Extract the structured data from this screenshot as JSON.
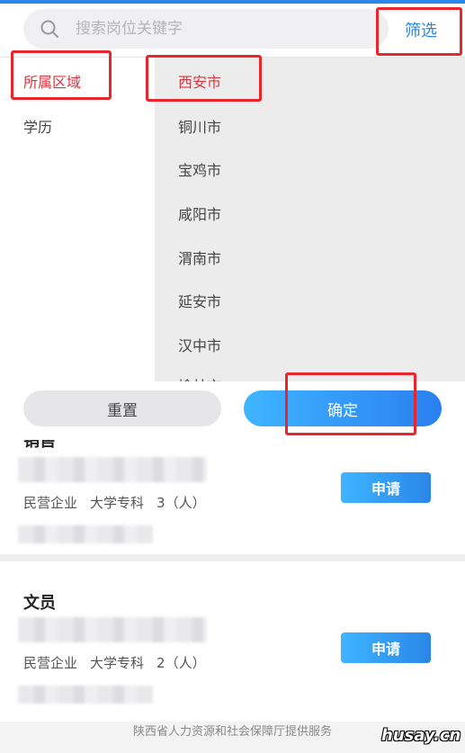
{
  "search": {
    "placeholder": "搜索岗位关键字"
  },
  "header": {
    "filter_label": "筛选"
  },
  "filter": {
    "categories": [
      {
        "label": "所属区域",
        "active": true
      },
      {
        "label": "学历",
        "active": false
      }
    ],
    "cities": [
      {
        "label": "西安市",
        "active": true
      },
      {
        "label": "铜川市"
      },
      {
        "label": "宝鸡市"
      },
      {
        "label": "咸阳市"
      },
      {
        "label": "渭南市"
      },
      {
        "label": "延安市"
      },
      {
        "label": "汉中市"
      },
      {
        "label": "榆林市"
      }
    ],
    "reset_label": "重置",
    "confirm_label": "确定"
  },
  "jobs": [
    {
      "title": "销售",
      "company_type": "民营企业",
      "education": "大学专科",
      "count": "3（人）",
      "apply_label": "申请"
    },
    {
      "title": "文员",
      "company_type": "民营企业",
      "education": "大学专科",
      "count": "2（人）",
      "apply_label": "申请"
    }
  ],
  "footer": {
    "text": "陕西省人力资源和社会保障厅提供服务"
  },
  "watermark": "husay.cn",
  "colors": {
    "accent": "#2a86e8",
    "active_red": "#d9363e",
    "highlight_box": "#e8262c"
  }
}
